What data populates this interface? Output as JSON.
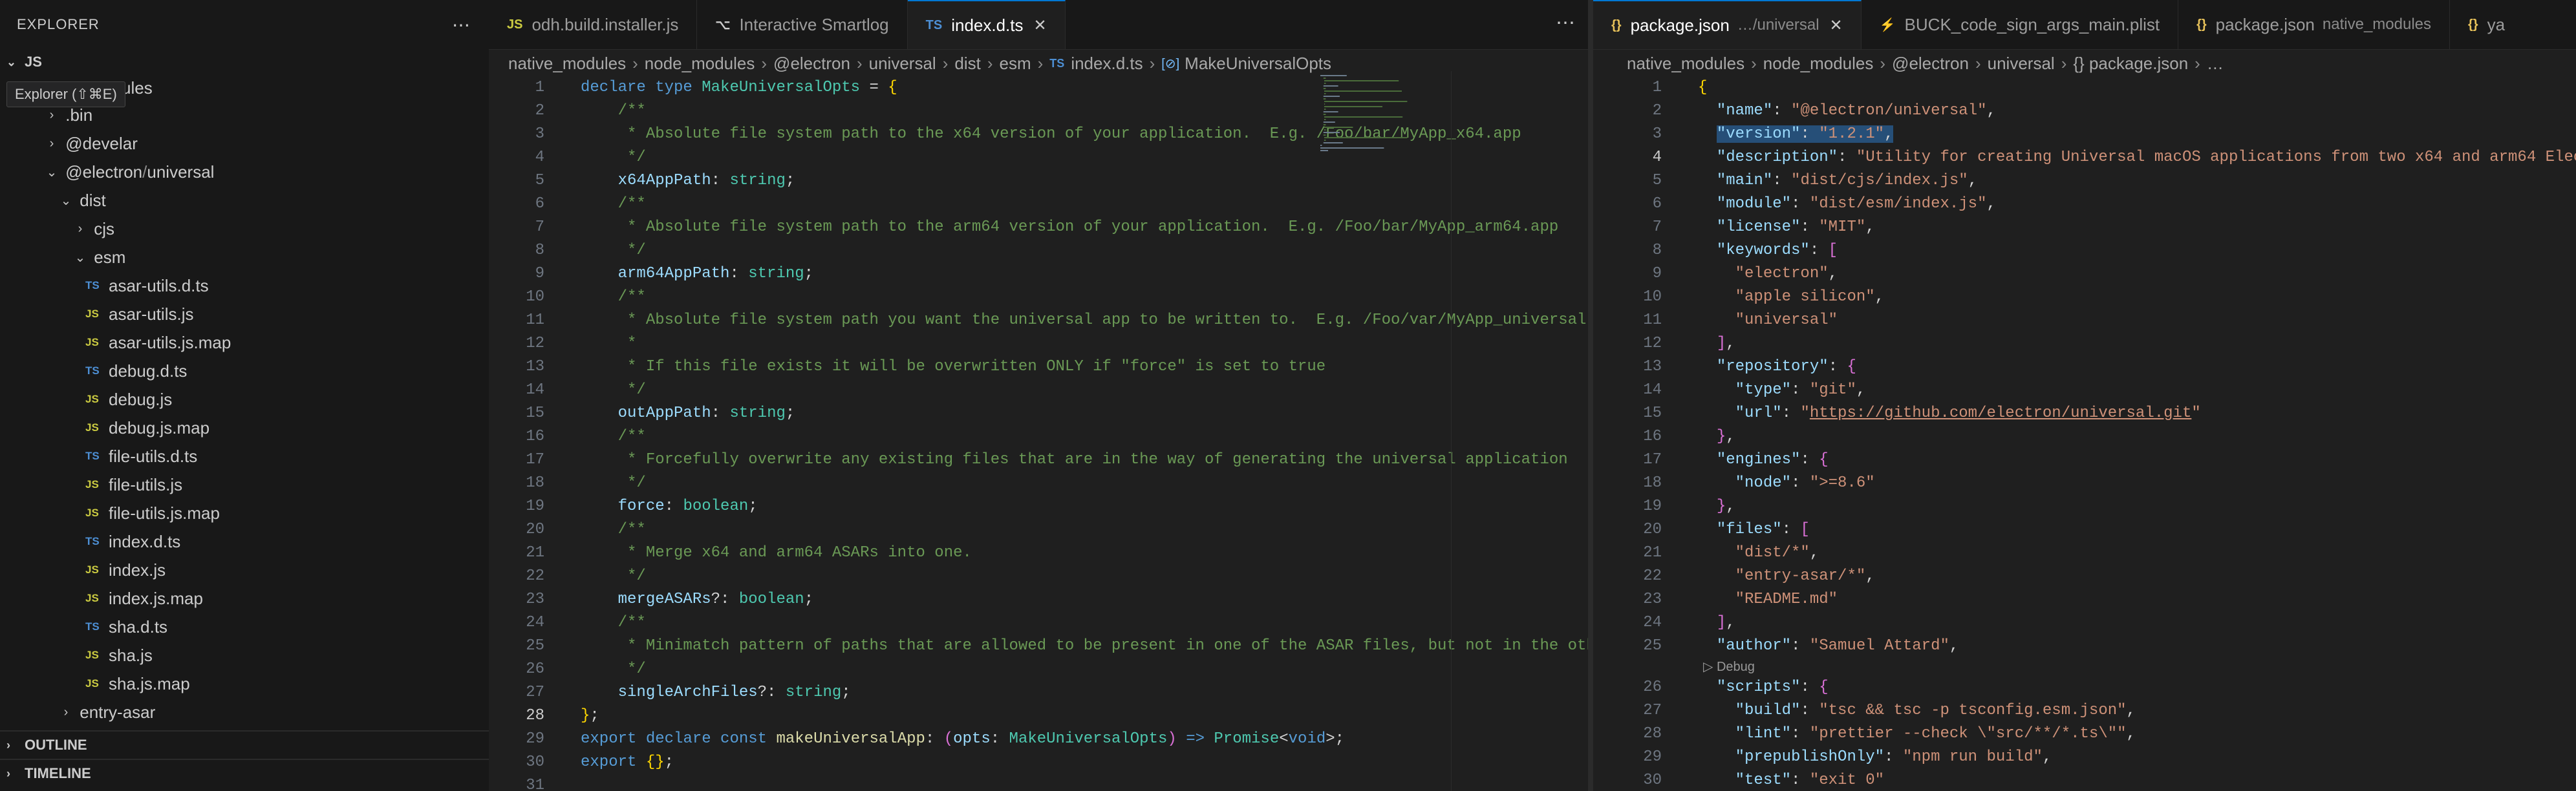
{
  "explorer": {
    "title": "EXPLORER",
    "more_icon": "ellipsis-icon",
    "workspace": "JS",
    "tooltip": "Explorer (⇧⌘E)",
    "hidden_label": "ules",
    "tree": [
      {
        "label": ".bin",
        "kind": "folder"
      },
      {
        "label": "@develar",
        "kind": "folder"
      },
      {
        "label": "@electron",
        "label2": "universal",
        "kind": "folder-open"
      },
      {
        "label": "dist",
        "kind": "folder-open"
      },
      {
        "label": "cjs",
        "kind": "folder"
      },
      {
        "label": "esm",
        "kind": "folder-open"
      },
      {
        "label": "asar-utils.d.ts",
        "icon": "TS"
      },
      {
        "label": "asar-utils.js",
        "icon": "JS"
      },
      {
        "label": "asar-utils.js.map",
        "icon": "JS"
      },
      {
        "label": "debug.d.ts",
        "icon": "TS"
      },
      {
        "label": "debug.js",
        "icon": "JS"
      },
      {
        "label": "debug.js.map",
        "icon": "JS"
      },
      {
        "label": "file-utils.d.ts",
        "icon": "TS"
      },
      {
        "label": "file-utils.js",
        "icon": "JS"
      },
      {
        "label": "file-utils.js.map",
        "icon": "JS"
      },
      {
        "label": "index.d.ts",
        "icon": "TS"
      },
      {
        "label": "index.js",
        "icon": "JS"
      },
      {
        "label": "index.js.map",
        "icon": "JS"
      },
      {
        "label": "sha.d.ts",
        "icon": "TS"
      },
      {
        "label": "sha.js",
        "icon": "JS"
      },
      {
        "label": "sha.js.map",
        "icon": "JS"
      },
      {
        "label": "entry-asar",
        "kind": "folder"
      }
    ],
    "outline": "OUTLINE",
    "timeline": "TIMELINE"
  },
  "left_editor": {
    "tabs": [
      {
        "icon": "JS",
        "label": "odh.build.installer.js"
      },
      {
        "icon": "⌥",
        "label": "Interactive Smartlog"
      },
      {
        "icon": "TS",
        "label": "index.d.ts",
        "active": true
      }
    ],
    "breadcrumb": [
      "native_modules",
      "node_modules",
      "@electron",
      "universal",
      "dist",
      "esm",
      "index.d.ts",
      "MakeUniversalOpts"
    ],
    "breadcrumb_icon_ts": "TS",
    "breadcrumb_icon_sym": "[⊘]",
    "current_line": 28
  },
  "right_editor": {
    "tabs": [
      {
        "icon": "{}",
        "label": "package.json",
        "sub": "…/universal",
        "active": true
      },
      {
        "icon": "⚡",
        "label": "BUCK_code_sign_args_main.plist"
      },
      {
        "icon": "{}",
        "label": "package.json",
        "sub": "native_modules"
      },
      {
        "icon": "{}",
        "label": "ya"
      }
    ],
    "breadcrumb": [
      "native_modules",
      "node_modules",
      "@electron",
      "universal",
      "{} package.json",
      "…"
    ],
    "codelens": "Debug",
    "current_line": 4
  },
  "colors": {
    "accent": "#0078d4",
    "ts_icon": "#4d8fd4",
    "js_icon": "#cbcb41",
    "json_icon": "#e8c25a"
  },
  "code_left": [
    {
      "n": "1",
      "t": [
        [
          "kw",
          "declare "
        ],
        [
          "kw",
          "type "
        ],
        [
          "ty",
          "MakeUniversalOpts"
        ],
        [
          "pn",
          " = "
        ],
        [
          "br2",
          "{"
        ]
      ]
    },
    {
      "n": "2",
      "t": [
        [
          "pn",
          "    "
        ],
        [
          "cm",
          "/**"
        ]
      ]
    },
    {
      "n": "3",
      "t": [
        [
          "pn",
          "    "
        ],
        [
          "cm",
          " * Absolute file system path to the x64 version of your application.  E.g. /Foo/bar/MyApp_x64.app"
        ]
      ]
    },
    {
      "n": "4",
      "t": [
        [
          "pn",
          "    "
        ],
        [
          "cm",
          " */"
        ]
      ]
    },
    {
      "n": "5",
      "t": [
        [
          "pn",
          "    "
        ],
        [
          "prop",
          "x64AppPath"
        ],
        [
          "pn",
          ": "
        ],
        [
          "ty",
          "string"
        ],
        [
          "pn",
          ";"
        ]
      ]
    },
    {
      "n": "6",
      "t": [
        [
          "pn",
          "    "
        ],
        [
          "cm",
          "/**"
        ]
      ]
    },
    {
      "n": "7",
      "t": [
        [
          "pn",
          "    "
        ],
        [
          "cm",
          " * Absolute file system path to the arm64 version of your application.  E.g. /Foo/bar/MyApp_arm64.app"
        ]
      ]
    },
    {
      "n": "8",
      "t": [
        [
          "pn",
          "    "
        ],
        [
          "cm",
          " */"
        ]
      ]
    },
    {
      "n": "9",
      "t": [
        [
          "pn",
          "    "
        ],
        [
          "prop",
          "arm64AppPath"
        ],
        [
          "pn",
          ": "
        ],
        [
          "ty",
          "string"
        ],
        [
          "pn",
          ";"
        ]
      ]
    },
    {
      "n": "10",
      "t": [
        [
          "pn",
          "    "
        ],
        [
          "cm",
          "/**"
        ]
      ]
    },
    {
      "n": "11",
      "t": [
        [
          "pn",
          "    "
        ],
        [
          "cm",
          " * Absolute file system path you want the universal app to be written to.  E.g. /Foo/var/MyApp_universal.app"
        ]
      ]
    },
    {
      "n": "12",
      "t": [
        [
          "pn",
          "    "
        ],
        [
          "cm",
          " *"
        ]
      ]
    },
    {
      "n": "13",
      "t": [
        [
          "pn",
          "    "
        ],
        [
          "cm",
          " * If this file exists it will be overwritten ONLY if \"force\" is set to true"
        ]
      ]
    },
    {
      "n": "14",
      "t": [
        [
          "pn",
          "    "
        ],
        [
          "cm",
          " */"
        ]
      ]
    },
    {
      "n": "15",
      "t": [
        [
          "pn",
          "    "
        ],
        [
          "prop",
          "outAppPath"
        ],
        [
          "pn",
          ": "
        ],
        [
          "ty",
          "string"
        ],
        [
          "pn",
          ";"
        ]
      ]
    },
    {
      "n": "16",
      "t": [
        [
          "pn",
          "    "
        ],
        [
          "cm",
          "/**"
        ]
      ]
    },
    {
      "n": "17",
      "t": [
        [
          "pn",
          "    "
        ],
        [
          "cm",
          " * Forcefully overwrite any existing files that are in the way of generating the universal application"
        ]
      ]
    },
    {
      "n": "18",
      "t": [
        [
          "pn",
          "    "
        ],
        [
          "cm",
          " */"
        ]
      ]
    },
    {
      "n": "19",
      "t": [
        [
          "pn",
          "    "
        ],
        [
          "prop",
          "force"
        ],
        [
          "pn",
          ": "
        ],
        [
          "ty",
          "boolean"
        ],
        [
          "pn",
          ";"
        ]
      ]
    },
    {
      "n": "20",
      "t": [
        [
          "pn",
          "    "
        ],
        [
          "cm",
          "/**"
        ]
      ]
    },
    {
      "n": "21",
      "t": [
        [
          "pn",
          "    "
        ],
        [
          "cm",
          " * Merge x64 and arm64 ASARs into one."
        ]
      ]
    },
    {
      "n": "22",
      "t": [
        [
          "pn",
          "    "
        ],
        [
          "cm",
          " */"
        ]
      ]
    },
    {
      "n": "23",
      "t": [
        [
          "pn",
          "    "
        ],
        [
          "prop",
          "mergeASARs"
        ],
        [
          "pn",
          "?: "
        ],
        [
          "ty",
          "boolean"
        ],
        [
          "pn",
          ";"
        ]
      ]
    },
    {
      "n": "24",
      "t": [
        [
          "pn",
          "    "
        ],
        [
          "cm",
          "/**"
        ]
      ]
    },
    {
      "n": "25",
      "t": [
        [
          "pn",
          "    "
        ],
        [
          "cm",
          " * Minimatch pattern of paths that are allowed to be present in one of the ASAR files, but not in the other."
        ]
      ]
    },
    {
      "n": "26",
      "t": [
        [
          "pn",
          "    "
        ],
        [
          "cm",
          " */"
        ]
      ]
    },
    {
      "n": "27",
      "t": [
        [
          "pn",
          "    "
        ],
        [
          "prop",
          "singleArchFiles"
        ],
        [
          "pn",
          "?: "
        ],
        [
          "ty",
          "string"
        ],
        [
          "pn",
          ";"
        ]
      ]
    },
    {
      "n": "28",
      "t": [
        [
          "br2",
          "}"
        ],
        [
          "pn",
          ";"
        ]
      ]
    },
    {
      "n": "29",
      "t": [
        [
          "kw",
          "export "
        ],
        [
          "kw",
          "declare "
        ],
        [
          "kw",
          "const "
        ],
        [
          "fn",
          "makeUniversalApp"
        ],
        [
          "pn",
          ": "
        ],
        [
          "br",
          "("
        ],
        [
          "prop",
          "opts"
        ],
        [
          "pn",
          ": "
        ],
        [
          "ty",
          "MakeUniversalOpts"
        ],
        [
          "br",
          ")"
        ],
        [
          "kw",
          " => "
        ],
        [
          "ty",
          "Promise"
        ],
        [
          "pn",
          "<"
        ],
        [
          "kw",
          "void"
        ],
        [
          "pn",
          ">;"
        ]
      ]
    },
    {
      "n": "30",
      "t": [
        [
          "kw",
          "export "
        ],
        [
          "br2",
          "{"
        ],
        [
          "br2",
          "}"
        ],
        [
          "pn",
          ";"
        ]
      ]
    },
    {
      "n": "31",
      "t": []
    }
  ],
  "code_right": [
    {
      "n": "1",
      "t": [
        [
          "br2",
          "{"
        ]
      ]
    },
    {
      "n": "2",
      "t": [
        [
          "pn",
          "  "
        ],
        [
          "key",
          "\"name\""
        ],
        [
          "pn",
          ": "
        ],
        [
          "str",
          "\"@electron/universal\""
        ],
        [
          "pn",
          ","
        ]
      ]
    },
    {
      "n": "3",
      "hl": true,
      "t": [
        [
          "pn",
          "  "
        ],
        [
          "key",
          "\"version\""
        ],
        [
          "pn",
          ": "
        ],
        [
          "str",
          "\"1.2.1\""
        ],
        [
          "pn",
          ","
        ]
      ]
    },
    {
      "n": "4",
      "t": [
        [
          "pn",
          "  "
        ],
        [
          "key",
          "\"description\""
        ],
        [
          "pn",
          ": "
        ],
        [
          "str",
          "\"Utility for creating Universal macOS applications from two x64 and arm64 Electron applications\""
        ],
        [
          "pn",
          ","
        ]
      ]
    },
    {
      "n": "5",
      "t": [
        [
          "pn",
          "  "
        ],
        [
          "key",
          "\"main\""
        ],
        [
          "pn",
          ": "
        ],
        [
          "str",
          "\"dist/cjs/index.js\""
        ],
        [
          "pn",
          ","
        ]
      ]
    },
    {
      "n": "6",
      "t": [
        [
          "pn",
          "  "
        ],
        [
          "key",
          "\"module\""
        ],
        [
          "pn",
          ": "
        ],
        [
          "str",
          "\"dist/esm/index.js\""
        ],
        [
          "pn",
          ","
        ]
      ]
    },
    {
      "n": "7",
      "t": [
        [
          "pn",
          "  "
        ],
        [
          "key",
          "\"license\""
        ],
        [
          "pn",
          ": "
        ],
        [
          "str",
          "\"MIT\""
        ],
        [
          "pn",
          ","
        ]
      ]
    },
    {
      "n": "8",
      "t": [
        [
          "pn",
          "  "
        ],
        [
          "key",
          "\"keywords\""
        ],
        [
          "pn",
          ": "
        ],
        [
          "br",
          "["
        ]
      ]
    },
    {
      "n": "9",
      "t": [
        [
          "pn",
          "    "
        ],
        [
          "str",
          "\"electron\""
        ],
        [
          "pn",
          ","
        ]
      ]
    },
    {
      "n": "10",
      "t": [
        [
          "pn",
          "    "
        ],
        [
          "str",
          "\"apple silicon\""
        ],
        [
          "pn",
          ","
        ]
      ]
    },
    {
      "n": "11",
      "t": [
        [
          "pn",
          "    "
        ],
        [
          "str",
          "\"universal\""
        ]
      ]
    },
    {
      "n": "12",
      "t": [
        [
          "pn",
          "  "
        ],
        [
          "br",
          "]"
        ],
        [
          "pn",
          ","
        ]
      ]
    },
    {
      "n": "13",
      "t": [
        [
          "pn",
          "  "
        ],
        [
          "key",
          "\"repository\""
        ],
        [
          "pn",
          ": "
        ],
        [
          "br",
          "{"
        ]
      ]
    },
    {
      "n": "14",
      "t": [
        [
          "pn",
          "    "
        ],
        [
          "key",
          "\"type\""
        ],
        [
          "pn",
          ": "
        ],
        [
          "str",
          "\"git\""
        ],
        [
          "pn",
          ","
        ]
      ]
    },
    {
      "n": "15",
      "t": [
        [
          "pn",
          "    "
        ],
        [
          "key",
          "\"url\""
        ],
        [
          "pn",
          ": "
        ],
        [
          "str",
          "\""
        ],
        [
          "url",
          "https://github.com/electron/universal.git"
        ],
        [
          "str",
          "\""
        ]
      ]
    },
    {
      "n": "16",
      "t": [
        [
          "pn",
          "  "
        ],
        [
          "br",
          "}"
        ],
        [
          "pn",
          ","
        ]
      ]
    },
    {
      "n": "17",
      "t": [
        [
          "pn",
          "  "
        ],
        [
          "key",
          "\"engines\""
        ],
        [
          "pn",
          ": "
        ],
        [
          "br",
          "{"
        ]
      ]
    },
    {
      "n": "18",
      "t": [
        [
          "pn",
          "    "
        ],
        [
          "key",
          "\"node\""
        ],
        [
          "pn",
          ": "
        ],
        [
          "str",
          "\">=8.6\""
        ]
      ]
    },
    {
      "n": "19",
      "t": [
        [
          "pn",
          "  "
        ],
        [
          "br",
          "}"
        ],
        [
          "pn",
          ","
        ]
      ]
    },
    {
      "n": "20",
      "t": [
        [
          "pn",
          "  "
        ],
        [
          "key",
          "\"files\""
        ],
        [
          "pn",
          ": "
        ],
        [
          "br",
          "["
        ]
      ]
    },
    {
      "n": "21",
      "t": [
        [
          "pn",
          "    "
        ],
        [
          "str",
          "\"dist/*\""
        ],
        [
          "pn",
          ","
        ]
      ]
    },
    {
      "n": "22",
      "t": [
        [
          "pn",
          "    "
        ],
        [
          "str",
          "\"entry-asar/*\""
        ],
        [
          "pn",
          ","
        ]
      ]
    },
    {
      "n": "23",
      "t": [
        [
          "pn",
          "    "
        ],
        [
          "str",
          "\"README.md\""
        ]
      ]
    },
    {
      "n": "24",
      "t": [
        [
          "pn",
          "  "
        ],
        [
          "br",
          "]"
        ],
        [
          "pn",
          ","
        ]
      ]
    },
    {
      "n": "25",
      "t": [
        [
          "pn",
          "  "
        ],
        [
          "key",
          "\"author\""
        ],
        [
          "pn",
          ": "
        ],
        [
          "str",
          "\"Samuel Attard\""
        ],
        [
          "pn",
          ","
        ]
      ]
    },
    {
      "n": "26",
      "lens": true,
      "t": [
        [
          "pn",
          "  "
        ],
        [
          "key",
          "\"scripts\""
        ],
        [
          "pn",
          ": "
        ],
        [
          "br",
          "{"
        ]
      ]
    },
    {
      "n": "27",
      "t": [
        [
          "pn",
          "    "
        ],
        [
          "key",
          "\"build\""
        ],
        [
          "pn",
          ": "
        ],
        [
          "str",
          "\"tsc && tsc -p tsconfig.esm.json\""
        ],
        [
          "pn",
          ","
        ]
      ]
    },
    {
      "n": "28",
      "t": [
        [
          "pn",
          "    "
        ],
        [
          "key",
          "\"lint\""
        ],
        [
          "pn",
          ": "
        ],
        [
          "str",
          "\"prettier --check \\\"src/**/*.ts\\\"\""
        ],
        [
          "pn",
          ","
        ]
      ]
    },
    {
      "n": "29",
      "t": [
        [
          "pn",
          "    "
        ],
        [
          "key",
          "\"prepublishOnly\""
        ],
        [
          "pn",
          ": "
        ],
        [
          "str",
          "\"npm run build\""
        ],
        [
          "pn",
          ","
        ]
      ]
    },
    {
      "n": "30",
      "t": [
        [
          "pn",
          "    "
        ],
        [
          "key",
          "\"test\""
        ],
        [
          "pn",
          ": "
        ],
        [
          "str",
          "\"exit 0\""
        ]
      ]
    }
  ]
}
